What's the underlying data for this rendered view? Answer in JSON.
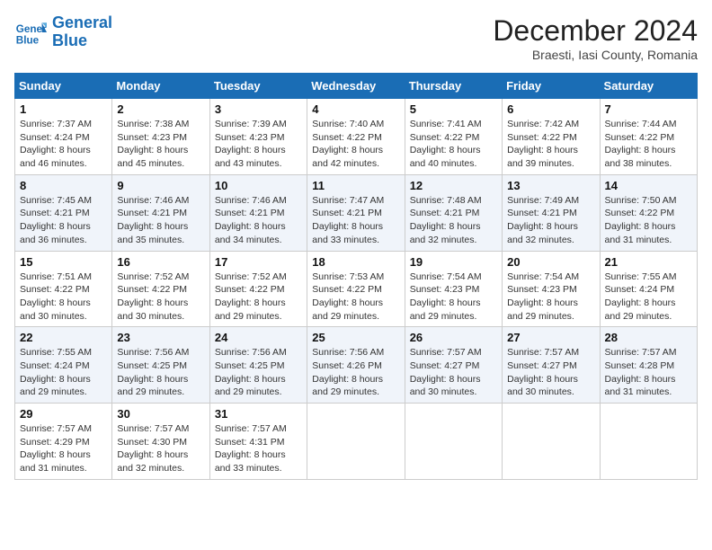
{
  "logo": {
    "line1": "General",
    "line2": "Blue"
  },
  "title": "December 2024",
  "location": "Braesti, Iasi County, Romania",
  "header": {
    "days": [
      "Sunday",
      "Monday",
      "Tuesday",
      "Wednesday",
      "Thursday",
      "Friday",
      "Saturday"
    ]
  },
  "weeks": [
    [
      {
        "day": "1",
        "sunrise": "7:37 AM",
        "sunset": "4:24 PM",
        "daylight": "8 hours and 46 minutes."
      },
      {
        "day": "2",
        "sunrise": "7:38 AM",
        "sunset": "4:23 PM",
        "daylight": "8 hours and 45 minutes."
      },
      {
        "day": "3",
        "sunrise": "7:39 AM",
        "sunset": "4:23 PM",
        "daylight": "8 hours and 43 minutes."
      },
      {
        "day": "4",
        "sunrise": "7:40 AM",
        "sunset": "4:22 PM",
        "daylight": "8 hours and 42 minutes."
      },
      {
        "day": "5",
        "sunrise": "7:41 AM",
        "sunset": "4:22 PM",
        "daylight": "8 hours and 40 minutes."
      },
      {
        "day": "6",
        "sunrise": "7:42 AM",
        "sunset": "4:22 PM",
        "daylight": "8 hours and 39 minutes."
      },
      {
        "day": "7",
        "sunrise": "7:44 AM",
        "sunset": "4:22 PM",
        "daylight": "8 hours and 38 minutes."
      }
    ],
    [
      {
        "day": "8",
        "sunrise": "7:45 AM",
        "sunset": "4:21 PM",
        "daylight": "8 hours and 36 minutes."
      },
      {
        "day": "9",
        "sunrise": "7:46 AM",
        "sunset": "4:21 PM",
        "daylight": "8 hours and 35 minutes."
      },
      {
        "day": "10",
        "sunrise": "7:46 AM",
        "sunset": "4:21 PM",
        "daylight": "8 hours and 34 minutes."
      },
      {
        "day": "11",
        "sunrise": "7:47 AM",
        "sunset": "4:21 PM",
        "daylight": "8 hours and 33 minutes."
      },
      {
        "day": "12",
        "sunrise": "7:48 AM",
        "sunset": "4:21 PM",
        "daylight": "8 hours and 32 minutes."
      },
      {
        "day": "13",
        "sunrise": "7:49 AM",
        "sunset": "4:21 PM",
        "daylight": "8 hours and 32 minutes."
      },
      {
        "day": "14",
        "sunrise": "7:50 AM",
        "sunset": "4:22 PM",
        "daylight": "8 hours and 31 minutes."
      }
    ],
    [
      {
        "day": "15",
        "sunrise": "7:51 AM",
        "sunset": "4:22 PM",
        "daylight": "8 hours and 30 minutes."
      },
      {
        "day": "16",
        "sunrise": "7:52 AM",
        "sunset": "4:22 PM",
        "daylight": "8 hours and 30 minutes."
      },
      {
        "day": "17",
        "sunrise": "7:52 AM",
        "sunset": "4:22 PM",
        "daylight": "8 hours and 29 minutes."
      },
      {
        "day": "18",
        "sunrise": "7:53 AM",
        "sunset": "4:22 PM",
        "daylight": "8 hours and 29 minutes."
      },
      {
        "day": "19",
        "sunrise": "7:54 AM",
        "sunset": "4:23 PM",
        "daylight": "8 hours and 29 minutes."
      },
      {
        "day": "20",
        "sunrise": "7:54 AM",
        "sunset": "4:23 PM",
        "daylight": "8 hours and 29 minutes."
      },
      {
        "day": "21",
        "sunrise": "7:55 AM",
        "sunset": "4:24 PM",
        "daylight": "8 hours and 29 minutes."
      }
    ],
    [
      {
        "day": "22",
        "sunrise": "7:55 AM",
        "sunset": "4:24 PM",
        "daylight": "8 hours and 29 minutes."
      },
      {
        "day": "23",
        "sunrise": "7:56 AM",
        "sunset": "4:25 PM",
        "daylight": "8 hours and 29 minutes."
      },
      {
        "day": "24",
        "sunrise": "7:56 AM",
        "sunset": "4:25 PM",
        "daylight": "8 hours and 29 minutes."
      },
      {
        "day": "25",
        "sunrise": "7:56 AM",
        "sunset": "4:26 PM",
        "daylight": "8 hours and 29 minutes."
      },
      {
        "day": "26",
        "sunrise": "7:57 AM",
        "sunset": "4:27 PM",
        "daylight": "8 hours and 30 minutes."
      },
      {
        "day": "27",
        "sunrise": "7:57 AM",
        "sunset": "4:27 PM",
        "daylight": "8 hours and 30 minutes."
      },
      {
        "day": "28",
        "sunrise": "7:57 AM",
        "sunset": "4:28 PM",
        "daylight": "8 hours and 31 minutes."
      }
    ],
    [
      {
        "day": "29",
        "sunrise": "7:57 AM",
        "sunset": "4:29 PM",
        "daylight": "8 hours and 31 minutes."
      },
      {
        "day": "30",
        "sunrise": "7:57 AM",
        "sunset": "4:30 PM",
        "daylight": "8 hours and 32 minutes."
      },
      {
        "day": "31",
        "sunrise": "7:57 AM",
        "sunset": "4:31 PM",
        "daylight": "8 hours and 33 minutes."
      },
      null,
      null,
      null,
      null
    ]
  ],
  "labels": {
    "sunrise": "Sunrise:",
    "sunset": "Sunset:",
    "daylight": "Daylight:"
  }
}
